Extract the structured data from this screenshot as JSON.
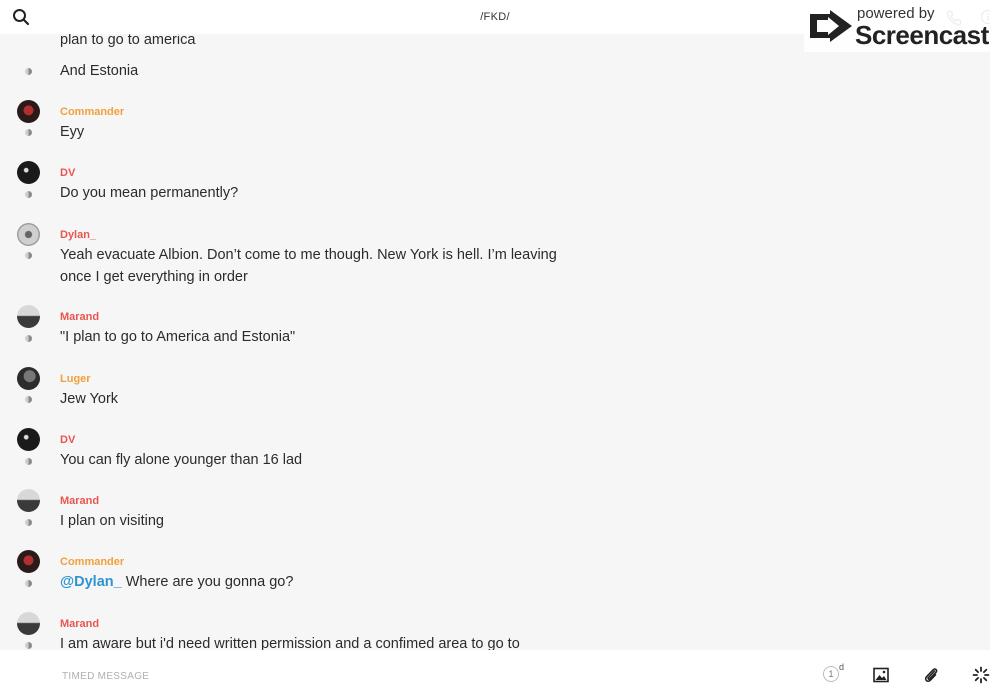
{
  "header": {
    "channel_title": "/FKD/"
  },
  "watermark": {
    "line1": "powered by",
    "line2": "Screencastify"
  },
  "messages": [
    {
      "continued": true,
      "text": "plan to go to america"
    },
    {
      "continued": true,
      "text": "And Estonia"
    },
    {
      "author": "Commander",
      "author_color": "#f0a03c",
      "text": "Eyy",
      "mention": ""
    },
    {
      "author": "DV",
      "author_color": "#e8564f",
      "text": "Do you mean permanently?",
      "mention": ""
    },
    {
      "author": "Dylan_",
      "author_color": "#e8564f",
      "text": "Yeah evacuate Albion. Don’t come to me though. New York is hell. I’m leaving once I get everything in order",
      "mention": ""
    },
    {
      "author": "Marand",
      "author_color": "#e8564f",
      "text": "\"I plan to go to America and Estonia\"",
      "mention": ""
    },
    {
      "author": "Luger",
      "author_color": "#f0a03c",
      "text": "Jew York",
      "mention": ""
    },
    {
      "author": "DV",
      "author_color": "#e8564f",
      "text": "You can fly alone younger than 16 lad",
      "mention": ""
    },
    {
      "author": "Marand",
      "author_color": "#e8564f",
      "text": "I plan on visiting",
      "mention": ""
    },
    {
      "author": "Commander",
      "author_color": "#f0a03c",
      "mention": "@Dylan_",
      "text": " Where are you gonna go?"
    },
    {
      "author": "Marand",
      "author_color": "#e8564f",
      "text": "I am aware but i'd need written permission and a confimed area to go to",
      "mention": ""
    }
  ],
  "composer": {
    "placeholder": "TIMED MESSAGE",
    "timer_value": "1",
    "timer_unit": "d"
  }
}
